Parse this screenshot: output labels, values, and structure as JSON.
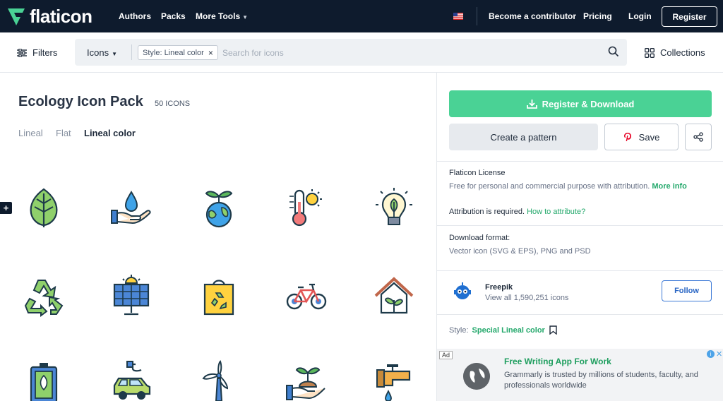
{
  "header": {
    "logo_text": "flaticon",
    "nav": [
      "Authors",
      "Packs",
      "More Tools"
    ],
    "contributor": "Become a contributor",
    "pricing": "Pricing",
    "login": "Login",
    "register": "Register"
  },
  "search": {
    "filters_label": "Filters",
    "type_label": "Icons",
    "chip_label": "Style: Lineal color",
    "chip_close": "×",
    "placeholder": "Search for icons",
    "collections_label": "Collections"
  },
  "pack": {
    "title": "Ecology Icon Pack",
    "count": "50 ICONS",
    "style_tabs": [
      "Lineal",
      "Flat",
      "Lineal color"
    ],
    "active_tab": "Lineal color",
    "add_label": "+",
    "icons": [
      "leaf-icon",
      "water-drop-hand-icon",
      "earth-sprout-icon",
      "thermometer-sun-icon",
      "eco-bulb-icon",
      "recycle-icon",
      "solar-panel-icon",
      "recycle-bag-icon",
      "bicycle-icon",
      "eco-house-icon",
      "eco-battery-icon",
      "electric-car-icon",
      "wind-turbine-icon",
      "plant-hand-icon",
      "water-tap-icon"
    ]
  },
  "panel": {
    "download": "Register & Download",
    "pattern": "Create a pattern",
    "save": "Save",
    "license_title": "Flaticon License",
    "license_desc": "Free for personal and commercial purpose with attribution.",
    "more_info": "More info",
    "attribution": "Attribution is required.",
    "how_to": "How to attribute?",
    "format_title": "Download format:",
    "format_desc": "Vector icon (SVG & EPS), PNG and PSD",
    "author_name": "Freepik",
    "author_sub": "View all 1,590,251 icons",
    "follow": "Follow",
    "style_label": "Style:",
    "style_value": "Special Lineal color"
  },
  "ad": {
    "badge": "Ad",
    "title": "Free Writing App For Work",
    "desc": "Grammarly is trusted by millions of students, faculty, and professionals worldwide",
    "info": "i",
    "close": "✕"
  },
  "colors": {
    "topbar": "#0e1b2d",
    "accent_green": "#4ad295",
    "link_green": "#23a86b",
    "follow_blue": "#2a66c4"
  }
}
